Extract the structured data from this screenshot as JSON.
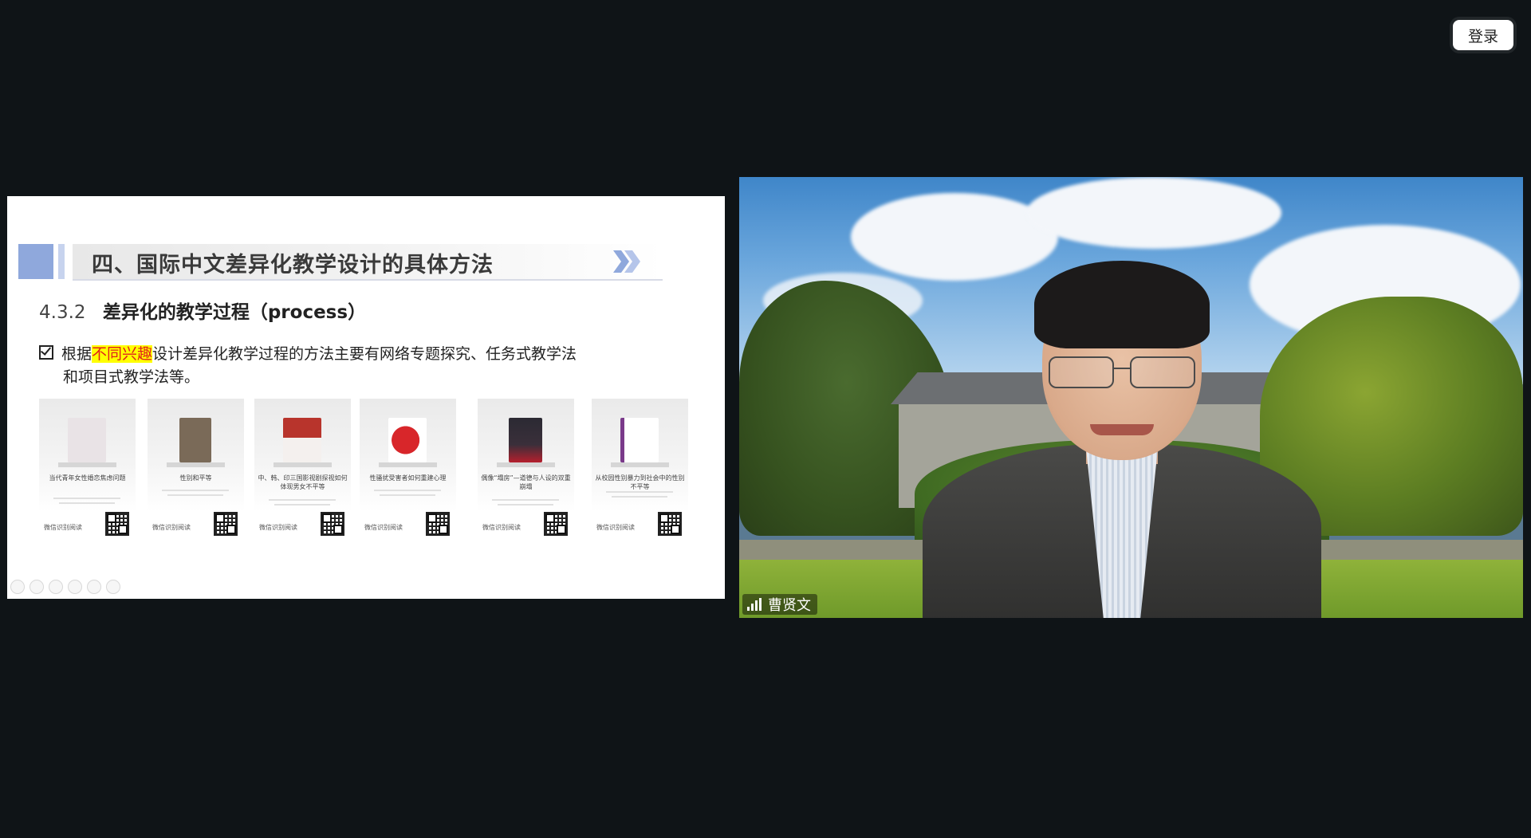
{
  "header": {
    "login_label": "登录"
  },
  "slide": {
    "title": "四、国际中文差异化教学设计的具体方法",
    "section_number": "4.3.2",
    "section_title": "差异化的教学过程（process）",
    "bullet": {
      "prefix": "根据",
      "highlight": "不同兴趣",
      "rest": "设计差异化教学过程的方法主要有网络专题探究、任务式教学法",
      "line2": "和项目式教学法等。"
    },
    "cards": [
      {
        "title": "当代青年女性婚恋焦虑问题",
        "scan_label": "微信识别阅读",
        "cover_color": "#e9e3e6"
      },
      {
        "title": "性别和平等",
        "scan_label": "微信识别阅读",
        "cover_color": "#7a6a58"
      },
      {
        "title": "中、韩、印三国影视剧探视如何体现男女不平等",
        "scan_label": "微信识别阅读",
        "cover_color": "#b8342c"
      },
      {
        "title": "性骚扰受害者如何重建心理",
        "scan_label": "微信识别阅读",
        "cover_color": "#d8262a"
      },
      {
        "title": "偶像“塌房”—道德与人设的双重崩塌",
        "scan_label": "微信识别阅读",
        "cover_color": "#2b2a33"
      },
      {
        "title": "从校园性别暴力到社会中的性别不平等",
        "scan_label": "微信识别阅读",
        "cover_color": "#7a3a8a"
      }
    ],
    "colors": {
      "highlight_bg": "#ffff00",
      "highlight_text": "#e0201c",
      "accent_blue": "#8fa8dc"
    }
  },
  "video": {
    "participant_name": "曹贤文"
  }
}
